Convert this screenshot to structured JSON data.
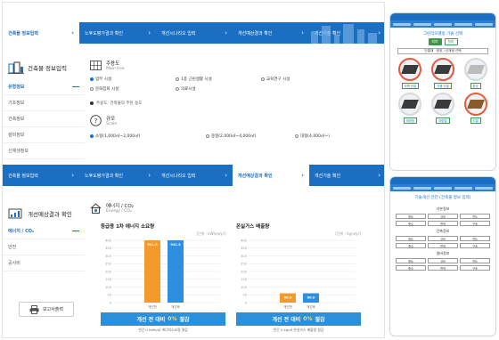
{
  "nav1": {
    "items": [
      {
        "label": "건축물 정보입력",
        "active": true
      },
      {
        "label": "노후도평가결과 확인",
        "active": false
      },
      {
        "label": "개선시나리오 입력",
        "active": false
      },
      {
        "label": "개선예상결과 확인",
        "active": false
      },
      {
        "label": "개선기술 확인",
        "active": false
      }
    ]
  },
  "section1": {
    "title": "건축물 정보입력",
    "sidebar": [
      {
        "label": "유형정보",
        "active": true
      },
      {
        "label": "기초정보",
        "active": false
      },
      {
        "label": "건축정보",
        "active": false
      },
      {
        "label": "설비정보",
        "active": false
      },
      {
        "label": "신재생정보",
        "active": false
      }
    ],
    "main_use": {
      "label": "주용도",
      "sub": "Main Use",
      "options": [
        {
          "label": "업무 시설",
          "selected": true
        },
        {
          "label": "1종 근린생활 시설",
          "selected": false
        },
        {
          "label": "교육연구 시설",
          "selected": false
        },
        {
          "label": "문화집회 시설",
          "selected": false
        },
        {
          "label": "의료시설",
          "selected": false
        }
      ],
      "note": "주용도: 건축물의 주된 용도"
    },
    "scale": {
      "label": "규모",
      "sub": "Scale",
      "options": [
        {
          "label": "소형(1,000㎡~2,000㎡)",
          "selected": true
        },
        {
          "label": "중형(2,000㎡~4,000㎡)",
          "selected": false
        },
        {
          "label": "대형(4,000㎡~)",
          "selected": false
        }
      ]
    }
  },
  "nav2": {
    "items": [
      {
        "label": "건축물 정보입력",
        "active": false
      },
      {
        "label": "노후도평가결과 확인",
        "active": false
      },
      {
        "label": "개선시나리오 입력",
        "active": false
      },
      {
        "label": "개선예상결과 확인",
        "active": true
      },
      {
        "label": "개선기술 확인",
        "active": false
      }
    ]
  },
  "section2": {
    "title": "개선예상결과 확인",
    "sidebar": [
      {
        "label": "에너지 / CO₂",
        "active": true
      },
      {
        "label": "안전",
        "active": false
      },
      {
        "label": "공사비",
        "active": false
      }
    ],
    "report_button": "보고서출력",
    "header": {
      "label": "에너지 / CO₂",
      "sub": "Energy / CO₂"
    },
    "save_prefix": "개선 전 대비",
    "save_suffix": "절감"
  },
  "chart_data": [
    {
      "type": "bar",
      "title": "등급용 1차 에너지 소요량",
      "unit": "[단위 : kWh/㎡yr]",
      "categories": [
        "개선전",
        "개선후"
      ],
      "values": [
        941.3,
        941.3
      ],
      "ylim": [
        0,
        400
      ],
      "yticks": [
        "400",
        "350",
        "300",
        "250",
        "200",
        "150",
        "100",
        "50",
        "0"
      ],
      "saving_pct": "0%",
      "sub_note": "연간 0 kWh/㎡ 에너지소요량 절감",
      "colors": [
        "#f39b2a",
        "#2e8ee0"
      ]
    },
    {
      "type": "bar",
      "title": "온실가스 배출량",
      "unit": "[단위 : kg/㎡yr]",
      "categories": [
        "개선전",
        "개선후"
      ],
      "values": [
        60.0,
        60.0
      ],
      "ylim": [
        0,
        400
      ],
      "yticks": [
        "400",
        "350",
        "300",
        "250",
        "200",
        "150",
        "100",
        "50",
        "0"
      ],
      "saving_pct": "0%",
      "sub_note": "연간 0 kg/㎡ 온실가스 배출량 절감",
      "colors": [
        "#f39b2a",
        "#2e8ee0"
      ]
    }
  ],
  "phone1": {
    "title": "그린리모델링 기술 선택",
    "tabs": [
      {
        "label": "외피",
        "on": true
      },
      {
        "label": "설비",
        "on": false
      }
    ],
    "select": "단열재 · 창호 / 신재생 선택",
    "cards": [
      "외벽 단열",
      "지붕 단열",
      "창호",
      "태양광",
      "태양열",
      "지열"
    ]
  },
  "phone2": {
    "title": "기술개선 안전 (건축물 정보 입력)",
    "sections": [
      "기본정보",
      "건축정보",
      "설비정보"
    ],
    "fields": [
      "용도",
      "규모",
      "연도",
      "층수",
      "면적",
      "구조"
    ]
  }
}
